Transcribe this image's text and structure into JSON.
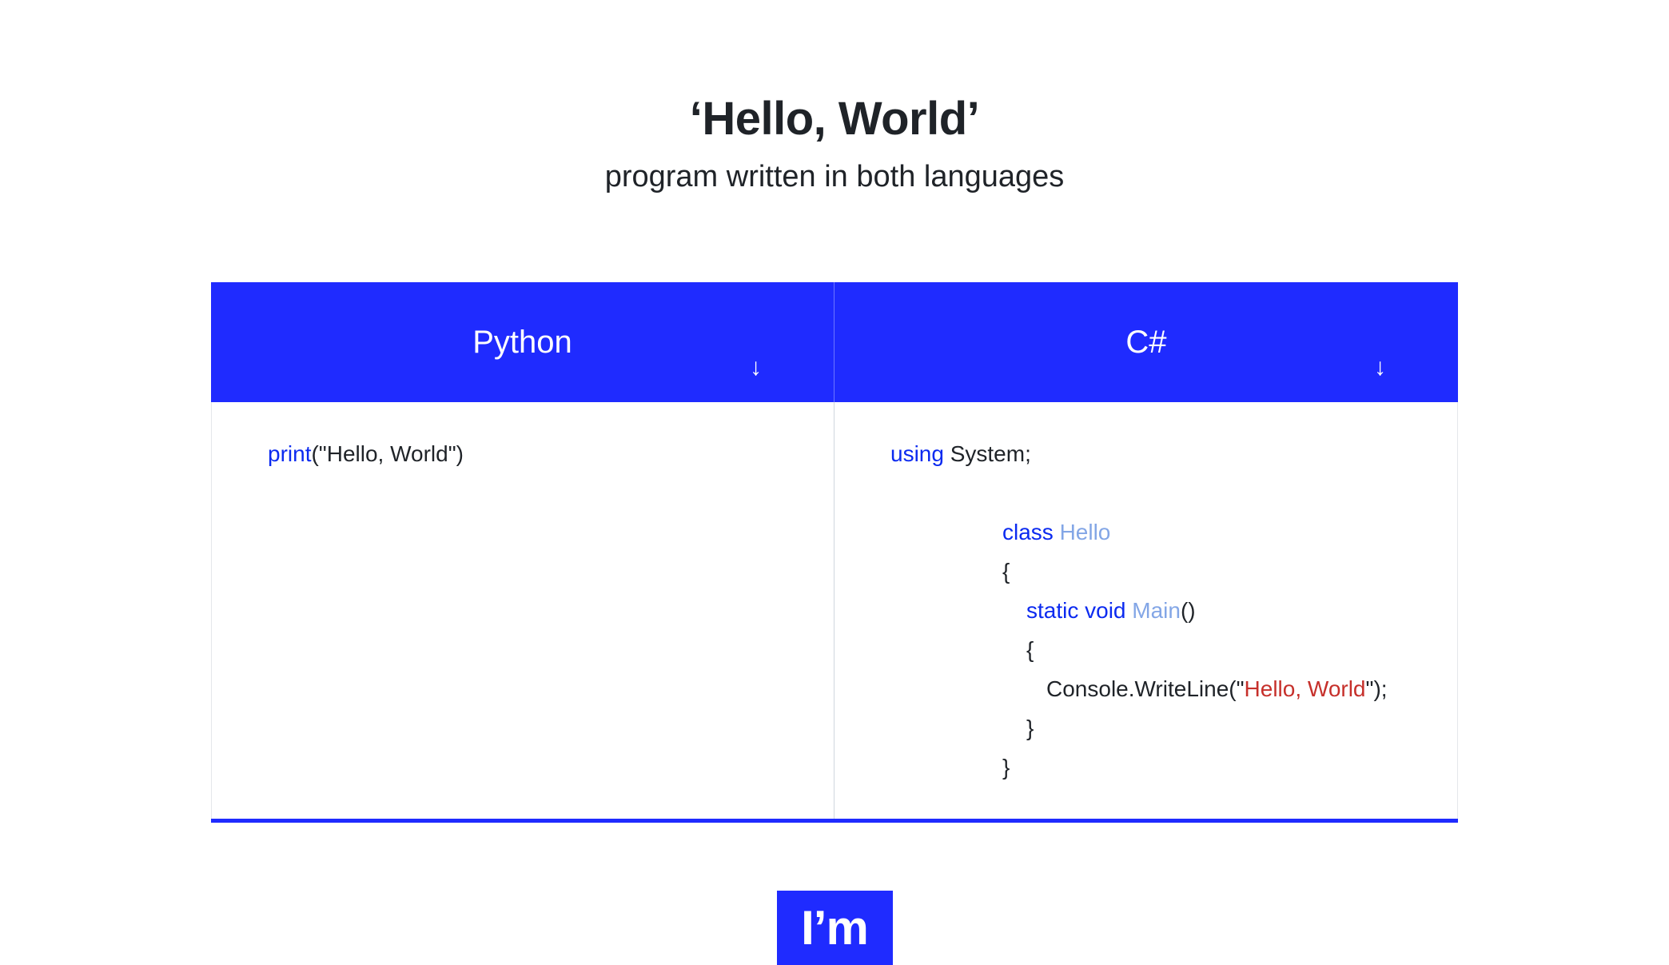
{
  "title": "‘Hello, World’",
  "subtitle": "program written in both languages",
  "columns": {
    "left": {
      "label": "Python"
    },
    "right": {
      "label": "C#"
    }
  },
  "code": {
    "python": {
      "kw_print": "print",
      "rest": "(\"Hello, World\")"
    },
    "csharp": {
      "kw_using": "using",
      "using_rest": " System;",
      "kw_class": "class",
      "type_hello": " Hello",
      "brace_open": "{",
      "kw_static_void": "static void",
      "type_main": " Main",
      "main_parens": "()",
      "inner_brace_open": "{",
      "console_pre": "Console.WriteLine(\"",
      "console_str": "Hello, World",
      "console_post": "\");",
      "inner_brace_close": "}",
      "brace_close": "}"
    }
  },
  "logo": "I’m",
  "colors": {
    "brand": "#1f2bff",
    "keyword": "#0b2af0",
    "type": "#83a6e6",
    "string": "#c6302b"
  }
}
